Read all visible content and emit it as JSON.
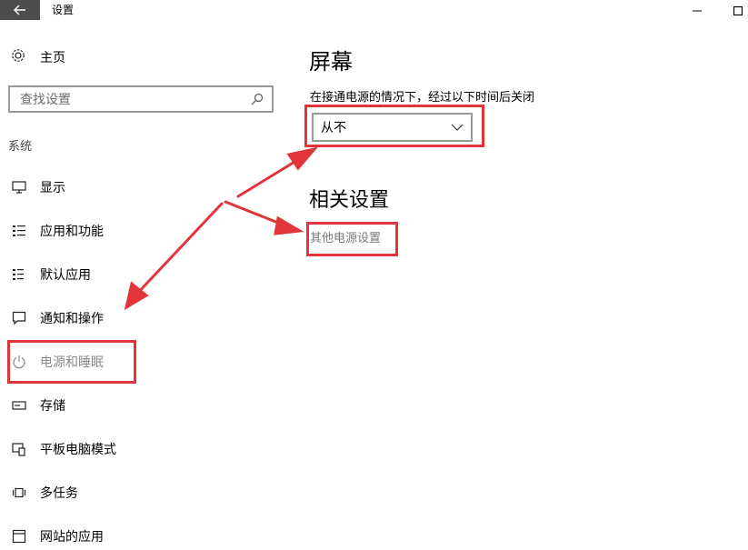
{
  "window": {
    "title": "设置",
    "back_icon": "back-arrow-icon",
    "minimize_icon": "minimize-icon",
    "maximize_icon": "maximize-icon"
  },
  "sidebar": {
    "home_label": "主页",
    "search_placeholder": "查找设置",
    "section_label": "系统",
    "items": [
      {
        "label": "显示",
        "icon": "monitor-icon",
        "active": false
      },
      {
        "label": "应用和功能",
        "icon": "apps-list-icon",
        "active": false
      },
      {
        "label": "默认应用",
        "icon": "default-apps-icon",
        "active": false
      },
      {
        "label": "通知和操作",
        "icon": "notification-icon",
        "active": false
      },
      {
        "label": "电源和睡眠",
        "icon": "power-icon",
        "active": true
      },
      {
        "label": "存储",
        "icon": "storage-icon",
        "active": false
      },
      {
        "label": "平板电脑模式",
        "icon": "tablet-mode-icon",
        "active": false
      },
      {
        "label": "多任务",
        "icon": "multitask-icon",
        "active": false
      },
      {
        "label": "网站的应用",
        "icon": "web-apps-icon",
        "active": false
      }
    ]
  },
  "main": {
    "screen_heading": "屏幕",
    "sleep_label": "在接通电源的情况下，经过以下时间后关闭",
    "sleep_dropdown_value": "从不",
    "related_heading": "相关设置",
    "power_link": "其他电源设置"
  },
  "colors": {
    "annotation": "#e0353b",
    "accent_gray": "#4d4d4d"
  }
}
